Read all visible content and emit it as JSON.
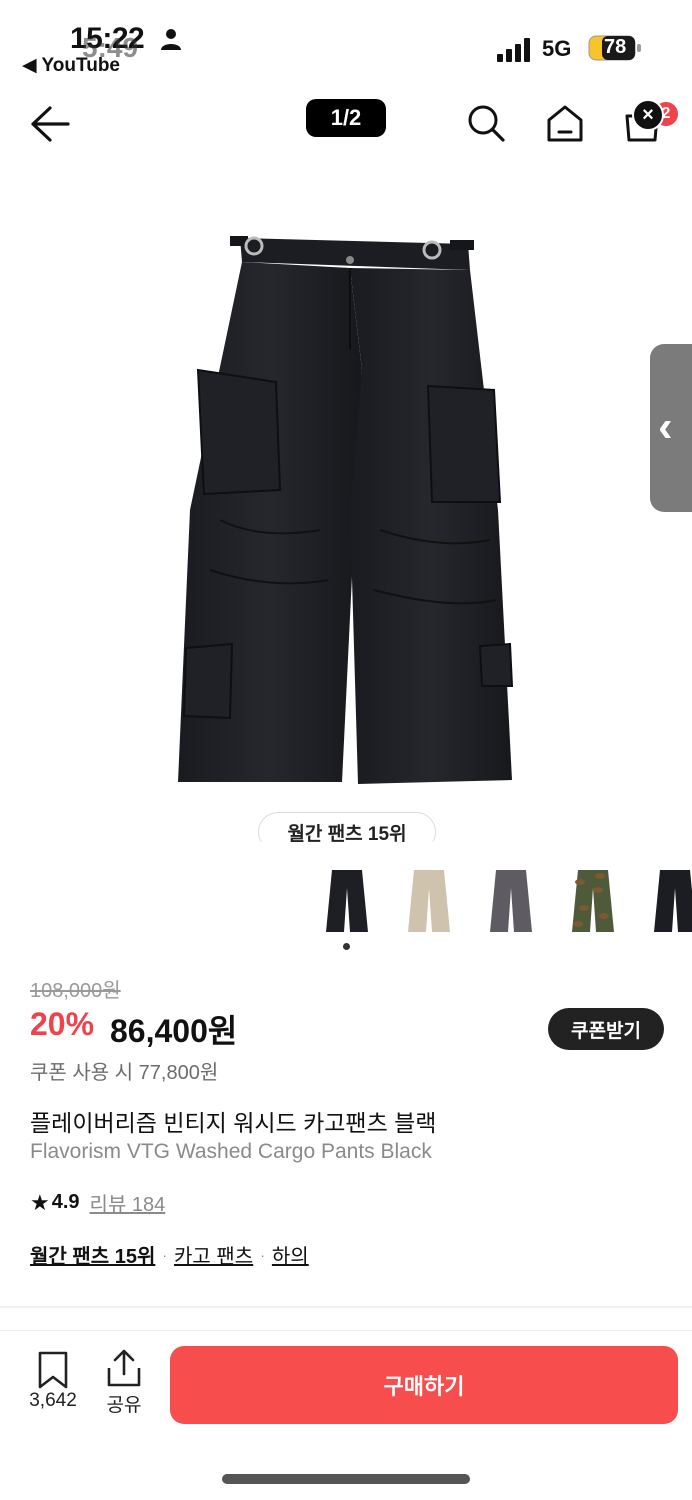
{
  "status_bar": {
    "time": "15:22",
    "time_overlay": "5:49",
    "back_app": "◀ YouTube",
    "network": "5G",
    "battery": "78"
  },
  "header": {
    "page_counter": "1/2",
    "cart_badge": "×",
    "cart_count": "2"
  },
  "product": {
    "rank_pill": "월간 팬츠 15위",
    "thumbnail_colors": [
      "#1d1f24",
      "#cfc3ad",
      "#5e5c62",
      "#4f5a3a",
      "#1b1d22"
    ],
    "selected_thumbnail": 0,
    "original_price": "108,000원",
    "discount": "20%",
    "price": "86,400원",
    "coupon_button": "쿠폰받기",
    "coupon_price": "쿠폰 사용 시 77,800원",
    "name_ko": "플레이버리즘 빈티지 워시드 카고팬츠 블랙",
    "name_en": "Flavorism VTG Washed Cargo Pants Black",
    "rating": "4.9",
    "review_label": "리뷰 184",
    "categories": [
      "월간 팬츠 15위",
      "카고 팬츠",
      "하의"
    ],
    "category_separator": "·"
  },
  "side_handle": "‹",
  "bottom_bar": {
    "bookmark_count": "3,642",
    "share_label": "공유",
    "buy_button": "구매하기"
  }
}
